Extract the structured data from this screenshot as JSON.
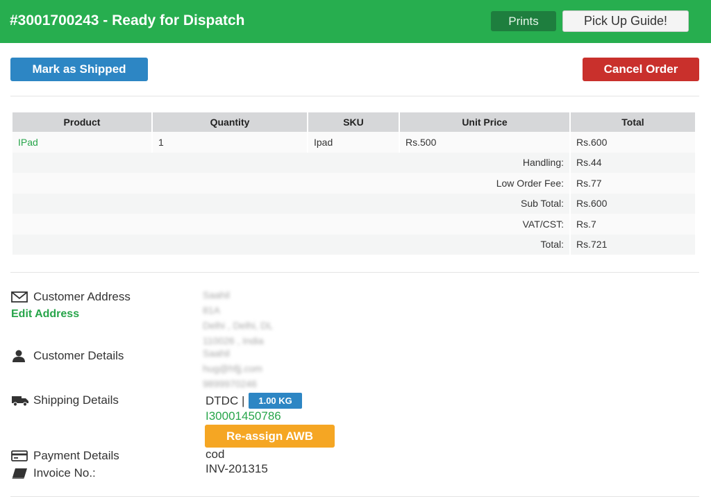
{
  "header": {
    "title": "#3001700243 - Ready for Dispatch",
    "prints_label": "Prints",
    "pickup_guide_label": "Pick Up Guide!"
  },
  "actions": {
    "mark_shipped_label": "Mark as Shipped",
    "cancel_order_label": "Cancel Order"
  },
  "table": {
    "headers": [
      "Product",
      "Quantity",
      "SKU",
      "Unit Price",
      "Total"
    ],
    "item": {
      "product": "IPad",
      "quantity": "1",
      "sku": "Ipad",
      "unit_price": "Rs.500",
      "total": "Rs.600"
    },
    "summary": [
      {
        "label": "Handling:",
        "value": "Rs.44"
      },
      {
        "label": "Low Order Fee:",
        "value": "Rs.77"
      },
      {
        "label": "Sub Total:",
        "value": "Rs.600"
      },
      {
        "label": "VAT/CST:",
        "value": "Rs.7"
      },
      {
        "label": "Total:",
        "value": "Rs.721"
      }
    ]
  },
  "customer_address": {
    "label": "Customer Address",
    "edit_label": "Edit Address",
    "icon": "envelope-icon",
    "lines": [
      "Saahil",
      "81A",
      "Delhi , Delhi, DL",
      "110026 , India"
    ]
  },
  "customer_details": {
    "label": "Customer Details",
    "icon": "user-icon",
    "lines": [
      "Saahil",
      "hug@hfjj.com",
      "9899970246"
    ]
  },
  "shipping": {
    "label": "Shipping Details",
    "icon": "truck-icon",
    "courier": "DTDC |",
    "weight": "1.00 KG",
    "awb": "I30001450786",
    "reassign_label": "Re-assign AWB"
  },
  "payment": {
    "label": "Payment Details",
    "icon": "credit-card-icon",
    "value": "cod"
  },
  "invoice": {
    "label": "Invoice No.:",
    "icon": "book-icon",
    "value": "INV-201315"
  },
  "colors": {
    "header_green": "#27ae4f",
    "primary_blue": "#2d86c4",
    "danger_red": "#c9302c",
    "warning_orange": "#f5a623",
    "link_green": "#27a54a"
  }
}
